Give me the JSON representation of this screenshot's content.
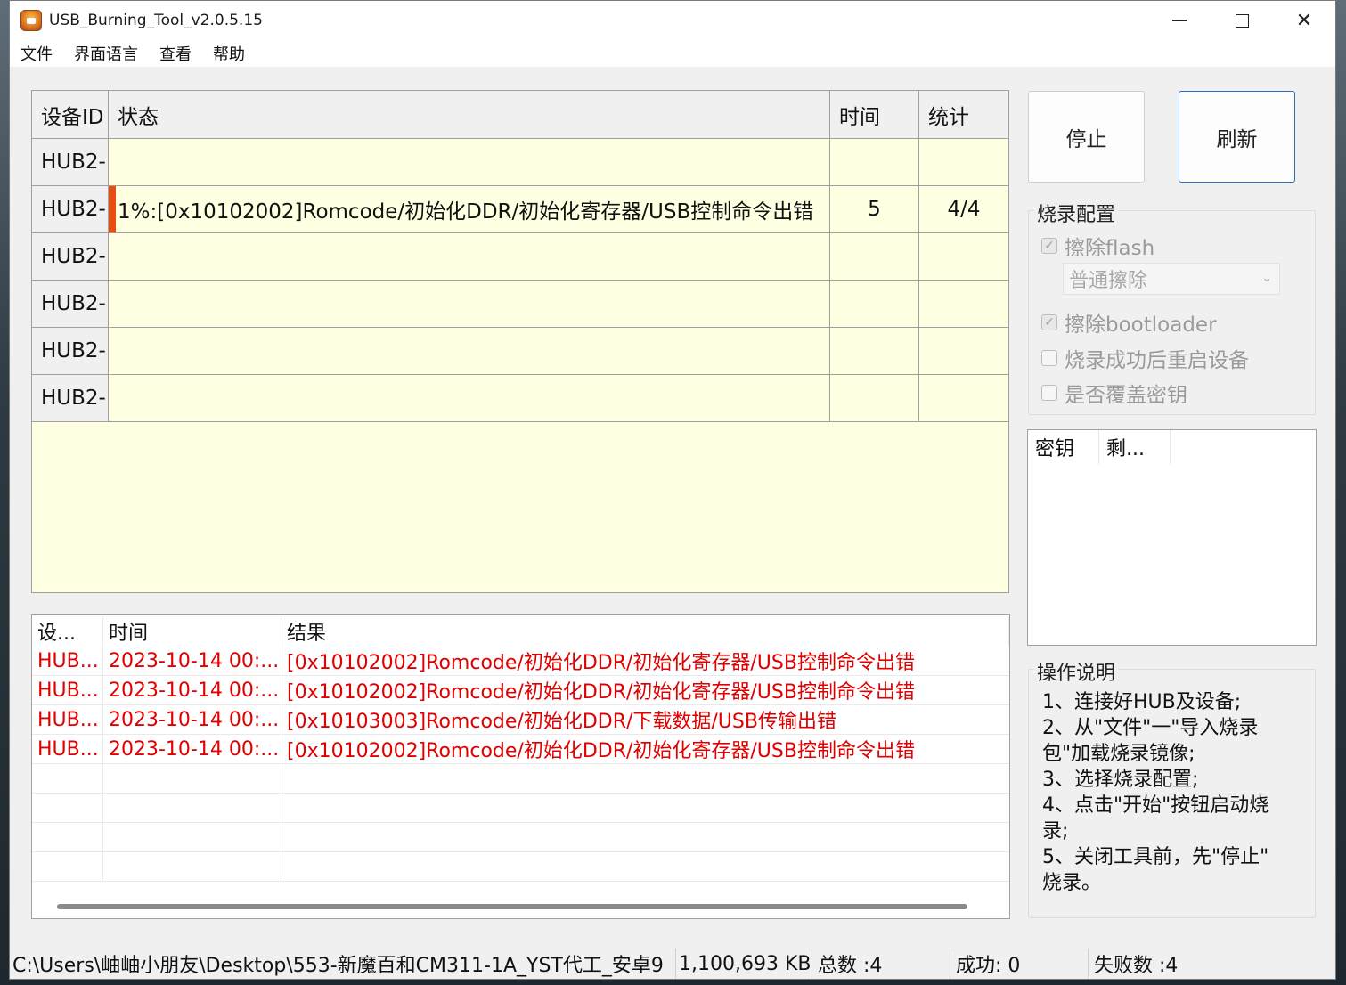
{
  "window": {
    "title": "USB_Burning_Tool_v2.0.5.15"
  },
  "menu": [
    "文件",
    "界面语言",
    "查看",
    "帮助"
  ],
  "device_grid": {
    "headers": {
      "id": "设备ID",
      "status": "状态",
      "time": "时间",
      "stat": "统计"
    },
    "rows": [
      {
        "id": "HUB2-",
        "status": "",
        "time": "",
        "stat": ""
      },
      {
        "id": "HUB2-",
        "status": "1%:[0x10102002]Romcode/初始化DDR/初始化寄存器/USB控制命令出错",
        "time": "5",
        "stat": "4/4"
      },
      {
        "id": "HUB2-",
        "status": "",
        "time": "",
        "stat": ""
      },
      {
        "id": "HUB2-",
        "status": "",
        "time": "",
        "stat": ""
      },
      {
        "id": "HUB2-",
        "status": "",
        "time": "",
        "stat": ""
      },
      {
        "id": "HUB2-",
        "status": "",
        "time": "",
        "stat": ""
      }
    ],
    "progress_color": "#e84d12"
  },
  "log": {
    "headers": {
      "device": "设...",
      "time": "时间",
      "result": "结果"
    },
    "rows": [
      {
        "device": "HUB...",
        "time": "2023-10-14 00:...",
        "result": "[0x10102002]Romcode/初始化DDR/初始化寄存器/USB控制命令出错"
      },
      {
        "device": "HUB...",
        "time": "2023-10-14 00:...",
        "result": "[0x10102002]Romcode/初始化DDR/初始化寄存器/USB控制命令出错"
      },
      {
        "device": "HUB...",
        "time": "2023-10-14 00:...",
        "result": "[0x10103003]Romcode/初始化DDR/下载数据/USB传输出错"
      },
      {
        "device": "HUB...",
        "time": "2023-10-14 00:...",
        "result": "[0x10102002]Romcode/初始化DDR/初始化寄存器/USB控制命令出错"
      }
    ],
    "error_color": "#e00000"
  },
  "buttons": {
    "stop": "停止",
    "refresh": "刷新"
  },
  "burn_config": {
    "title": "烧录配置",
    "erase_flash": {
      "label": "擦除flash",
      "checked": true,
      "disabled": true
    },
    "erase_mode": {
      "selected": "普通擦除"
    },
    "erase_bootloader": {
      "label": "擦除bootloader",
      "checked": true,
      "disabled": true
    },
    "reboot_after": {
      "label": "烧录成功后重启设备",
      "checked": false,
      "disabled": true
    },
    "overwrite_key": {
      "label": "是否覆盖密钥",
      "checked": false,
      "disabled": true
    }
  },
  "key_list": {
    "headers": [
      "密钥",
      "剩..."
    ]
  },
  "help": {
    "title": "操作说明",
    "lines": [
      "1、连接好HUB及设备;",
      "2、从\"文件\"一\"导入烧录",
      "包\"加载烧录镜像;",
      "3、选择烧录配置;",
      "4、点击\"开始\"按钮启动烧",
      "录;",
      "5、关闭工具前，先\"停止\"",
      "烧录。"
    ]
  },
  "statusbar": {
    "path": "C:\\Users\\岫岫小朋友\\Desktop\\553-新魔百和CM311-1A_YST代工_安卓9",
    "size": "1,100,693 KB",
    "total": "总数 :4",
    "success": "成功:  0",
    "fail": "失败数 :4"
  }
}
